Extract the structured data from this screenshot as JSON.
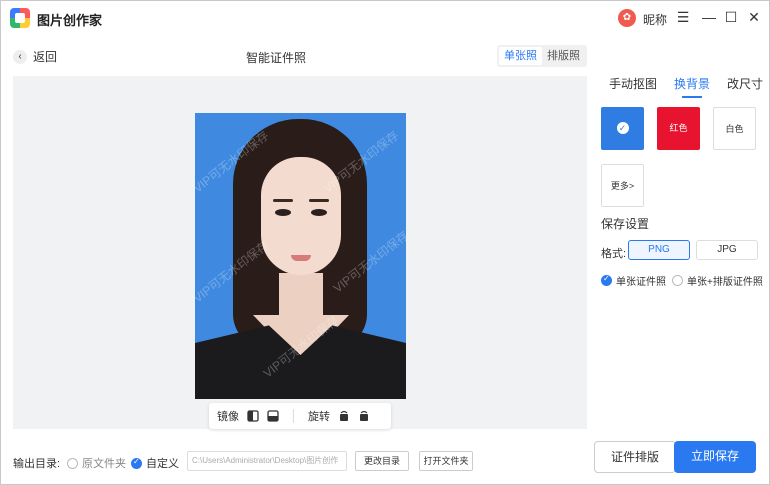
{
  "app": {
    "title": "图片创作家",
    "avatar_glyph": "✿",
    "nickname": "昵称"
  },
  "window": {
    "menu": "☰",
    "minimize": "—",
    "maximize": "☐",
    "close": "✕"
  },
  "header": {
    "back_label": "返回",
    "page_title": "智能证件照",
    "tabs": [
      "单张照",
      "排版照"
    ],
    "active_tab": "单张照"
  },
  "canvas": {
    "watermark": "VIP可无水印保存"
  },
  "toolbar": {
    "mirror_label": "镜像",
    "rotate_label": "旋转"
  },
  "right_panel": {
    "tabs": [
      "手动抠图",
      "换背景",
      "改尺寸"
    ],
    "active_tab": "换背景",
    "backgrounds": [
      {
        "label": "✓",
        "color": "#2f7de3",
        "selected": true
      },
      {
        "label": "红色",
        "color": "#e8132e"
      },
      {
        "label": "白色",
        "color": "#ffffff"
      },
      {
        "label": "更多>",
        "color": "#ffffff"
      }
    ],
    "save_title": "保存设置",
    "format_label": "格式:",
    "formats": [
      "PNG",
      "JPG"
    ],
    "selected_format": "PNG",
    "save_options": [
      "单张证件照",
      "单张+排版证件照"
    ],
    "selected_option": "单张证件照"
  },
  "bottom": {
    "output_label": "输出目录:",
    "dir_options": [
      "原文件夹",
      "自定义"
    ],
    "selected_dir": "自定义",
    "path_value": "C:\\Users\\Administrator\\Desktop\\图片创作",
    "change_dir_label": "更改目录",
    "open_folder_label": "打开文件夹",
    "layout_button": "证件排版",
    "save_button": "立即保存"
  },
  "colors": {
    "accent": "#2a79f0",
    "photo_bg": "#3f8ae0"
  }
}
